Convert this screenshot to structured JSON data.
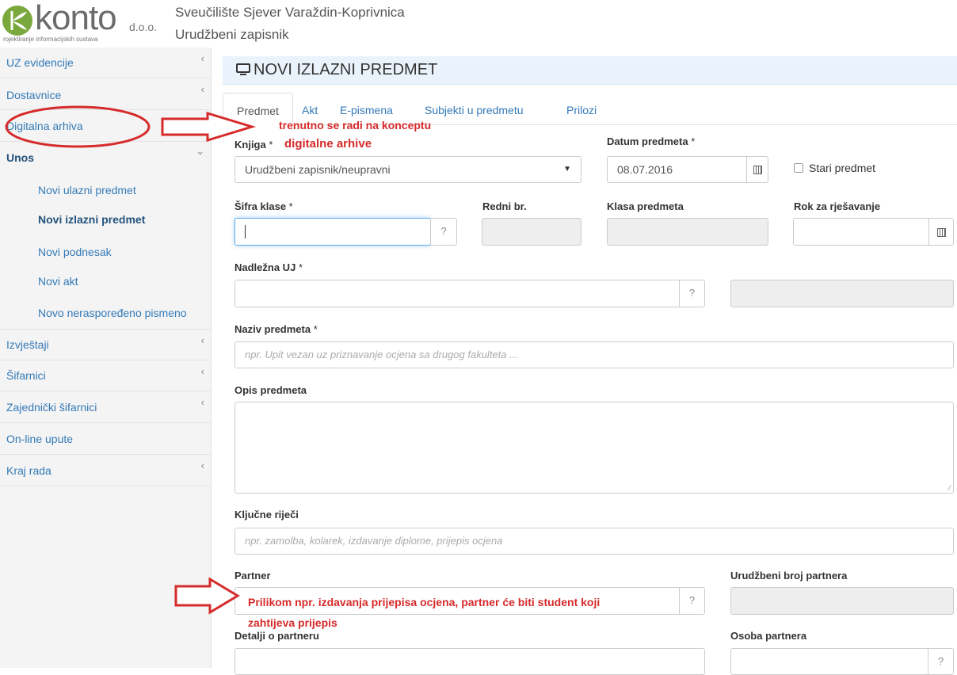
{
  "header": {
    "logo_text": "konto",
    "logo_suffix": "d.o.o.",
    "logo_tagline": "rojektiranje informacijskih sustava",
    "org_name": "Sveučilište Sjever Varaždin-Koprivnica",
    "module_name": "Urudžbeni zapisnik"
  },
  "sidebar": {
    "items": [
      {
        "label": "UZ evidencije",
        "chevron": "‹"
      },
      {
        "label": "Dostavnice",
        "chevron": "‹"
      },
      {
        "label": "Digitalna arhiva",
        "chevron": "‹"
      },
      {
        "label": "Unos",
        "chevron": "⌄"
      },
      {
        "label": "Izvještaji",
        "chevron": "‹"
      },
      {
        "label": "Šifarnici",
        "chevron": "‹"
      },
      {
        "label": "Zajednički šifarnici",
        "chevron": "‹"
      },
      {
        "label": "On-line upute",
        "chevron": ""
      },
      {
        "label": "Kraj rada",
        "chevron": "‹"
      }
    ],
    "sub_items": [
      {
        "label": "Novi ulazni predmet"
      },
      {
        "label": "Novi izlazni predmet"
      },
      {
        "label": "Novi podnesak"
      },
      {
        "label": "Novi akt"
      },
      {
        "label": "Novo neraspoređeno pismeno"
      }
    ]
  },
  "main": {
    "title": "NOVI IZLAZNI PREDMET",
    "tabs": [
      "Predmet",
      "Akt",
      "E-pismena",
      "Subjekti u predmetu",
      "Prilozi"
    ],
    "fields": {
      "knjiga_label": "Knjiga",
      "knjiga_value": "Urudžbeni zapisnik/neupravni",
      "datum_label": "Datum predmeta",
      "datum_value": "08.07.2016",
      "stari_label": "Stari predmet",
      "sifra_label": "Šifra klase",
      "redni_label": "Redni br.",
      "klasa_label": "Klasa predmeta",
      "rok_label": "Rok za rješavanje",
      "nadlezna_label": "Nadležna UJ",
      "naziv_label": "Naziv predmeta",
      "naziv_placeholder": "npr. Upit vezan uz priznavanje ocjena sa drugog fakulteta ...",
      "opis_label": "Opis predmeta",
      "kljucne_label": "Ključne riječi",
      "kljucne_placeholder": "npr. zamolba, kolarek, izdavanje diplome, prijepis ocjena",
      "partner_label": "Partner",
      "urudzbeni_label": "Urudžbeni broj partnera",
      "detalji_label": "Detalji o partneru",
      "osoba_label": "Osoba partnera",
      "required_mark": "*",
      "lookup_mark": "?"
    }
  },
  "annotations": {
    "note1": "trenutno se radi na konceptu",
    "note2": "digitalne arhive",
    "note3_line1": "Prilikom npr. izdavanja prijepisa ocjena, partner će biti student koji",
    "note3_line2": "zahtijeva prijepis",
    "color": "#d62b2b"
  }
}
